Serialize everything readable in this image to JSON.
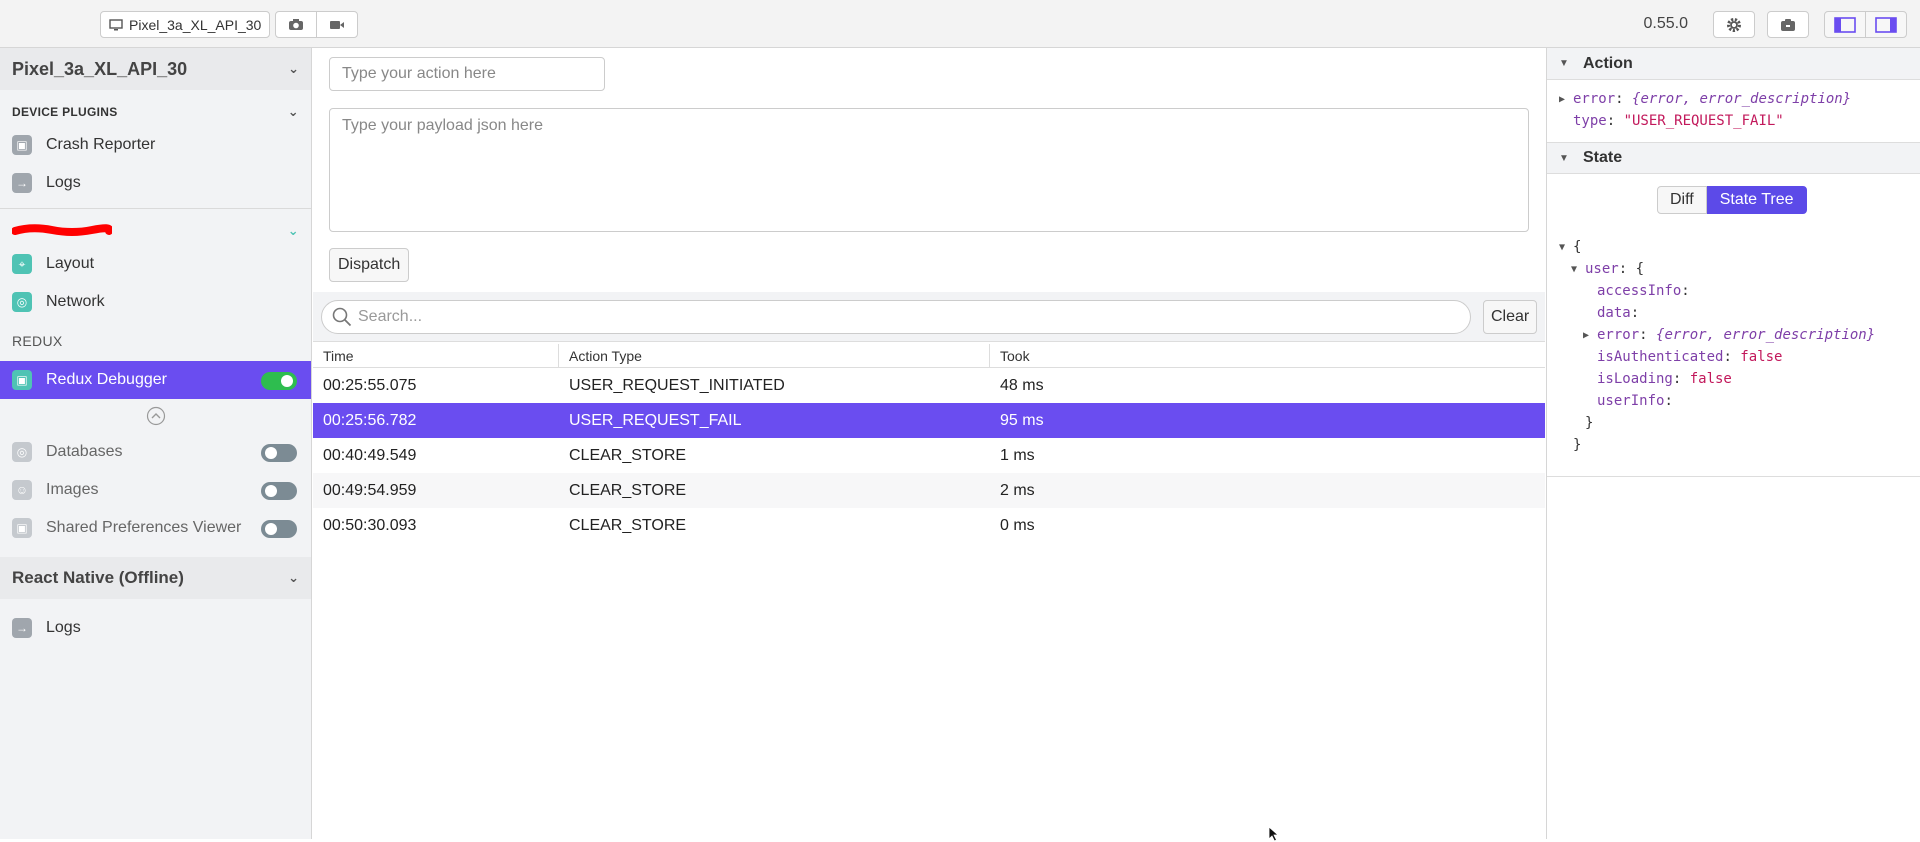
{
  "toolbar": {
    "device_label": "Pixel_3a_XL_API_30",
    "version": "0.55.0"
  },
  "sidebar": {
    "device": "Pixel_3a_XL_API_30",
    "device_plugins_heading": "DEVICE PLUGINS",
    "device_plugins": [
      {
        "label": "Crash Reporter",
        "icon": "box-icon"
      },
      {
        "label": "Logs",
        "icon": "arrow-right-icon"
      }
    ],
    "app_plugins": [
      {
        "label": "Layout",
        "icon": "layout-icon"
      },
      {
        "label": "Network",
        "icon": "globe-icon"
      }
    ],
    "redux_heading": "REDUX",
    "redux_debugger": "Redux Debugger",
    "disabled_plugins": [
      {
        "label": "Databases"
      },
      {
        "label": "Images"
      },
      {
        "label": "Shared Preferences Viewer"
      }
    ],
    "react_native": "React Native (Offline)",
    "rn_logs": "Logs"
  },
  "main": {
    "action_placeholder": "Type your action here",
    "payload_placeholder": "Type your payload json here",
    "dispatch_label": "Dispatch",
    "search_placeholder": "Search...",
    "clear_label": "Clear",
    "columns": [
      "Time",
      "Action Type",
      "Took"
    ],
    "rows": [
      {
        "time": "00:25:55.075",
        "type": "USER_REQUEST_INITIATED",
        "took": "48 ms",
        "selected": false
      },
      {
        "time": "00:25:56.782",
        "type": "USER_REQUEST_FAIL",
        "took": "95 ms",
        "selected": true
      },
      {
        "time": "00:40:49.549",
        "type": "CLEAR_STORE",
        "took": "1 ms",
        "selected": false
      },
      {
        "time": "00:49:54.959",
        "type": "CLEAR_STORE",
        "took": "2 ms",
        "selected": false
      },
      {
        "time": "00:50:30.093",
        "type": "CLEAR_STORE",
        "took": "0 ms",
        "selected": false
      }
    ]
  },
  "right": {
    "action_heading": "Action",
    "action_error_key": "error",
    "action_error_val": "{error, error_description}",
    "action_type_key": "type",
    "action_type_val": "\"USER_REQUEST_FAIL\"",
    "state_heading": "State",
    "diff_label": "Diff",
    "state_tree_label": "State Tree",
    "tree": {
      "open": "{",
      "user_key": "user",
      "user_open": "{",
      "access_info": "accessInfo",
      "data": "data",
      "error_key": "error",
      "error_val": "{error, error_description}",
      "is_auth_key": "isAuthenticated",
      "is_auth_val": "false",
      "is_loading_key": "isLoading",
      "is_loading_val": "false",
      "user_info": "userInfo",
      "user_close": "}",
      "close": "}"
    }
  },
  "colors": {
    "accent": "#6a4df0",
    "toggle_on": "#2ebd4f",
    "plugin_icon": "#a0a6ad",
    "app_icon": "#4fc3b4"
  }
}
